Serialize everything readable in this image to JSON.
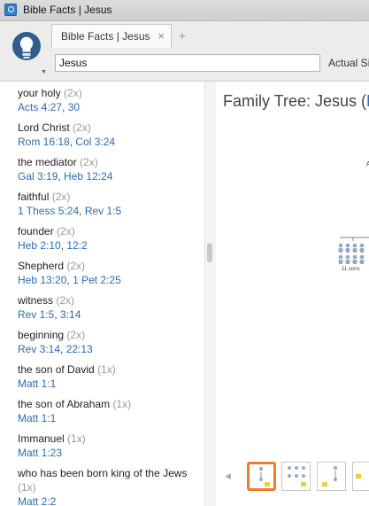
{
  "window": {
    "title": "Bible Facts | Jesus"
  },
  "tabs": [
    {
      "label": "Bible Facts | Jesus"
    }
  ],
  "search": {
    "value": "Jesus"
  },
  "toolbar": {
    "actual_size_label": "Actual Si"
  },
  "facts": [
    {
      "term": "your holy",
      "count": "(2x)",
      "refs": [
        "Acts 4:27",
        "30"
      ]
    },
    {
      "term": "Lord Christ",
      "count": "(2x)",
      "refs": [
        "Rom 16:18",
        "Col 3:24"
      ]
    },
    {
      "term": "the mediator",
      "count": "(2x)",
      "refs": [
        "Gal 3:19",
        "Heb 12:24"
      ]
    },
    {
      "term": "faithful",
      "count": "(2x)",
      "refs": [
        "1 Thess 5:24",
        "Rev 1:5"
      ]
    },
    {
      "term": "founder",
      "count": "(2x)",
      "refs": [
        "Heb 2:10",
        "12:2"
      ]
    },
    {
      "term": "Shepherd",
      "count": "(2x)",
      "refs": [
        "Heb 13:20",
        "1 Pet 2:25"
      ]
    },
    {
      "term": "witness",
      "count": "(2x)",
      "refs": [
        "Rev 1:5",
        "3:14"
      ]
    },
    {
      "term": "beginning",
      "count": "(2x)",
      "refs": [
        "Rev 3:14",
        "22:13"
      ]
    },
    {
      "term": "the son of David",
      "count": "(1x)",
      "refs": [
        "Matt 1:1"
      ]
    },
    {
      "term": "the son of Abraham",
      "count": "(1x)",
      "refs": [
        "Matt 1:1"
      ]
    },
    {
      "term": "Immanuel",
      "count": "(1x)",
      "refs": [
        "Matt 1:23"
      ]
    },
    {
      "term": "who has been born king of the Jews",
      "count": "(1x)",
      "refs": [
        "Matt 2:2"
      ]
    }
  ],
  "family_tree": {
    "title_prefix": "Family Tree: Jesus (",
    "title_accent": "M",
    "peek_char": "A",
    "sons_label": "11 sons"
  },
  "colors": {
    "link": "#2a6bb3",
    "accent_orange": "#ee7d2a"
  },
  "icons": {
    "app": "logos-app-icon",
    "brand": "lightbulb-icon"
  }
}
